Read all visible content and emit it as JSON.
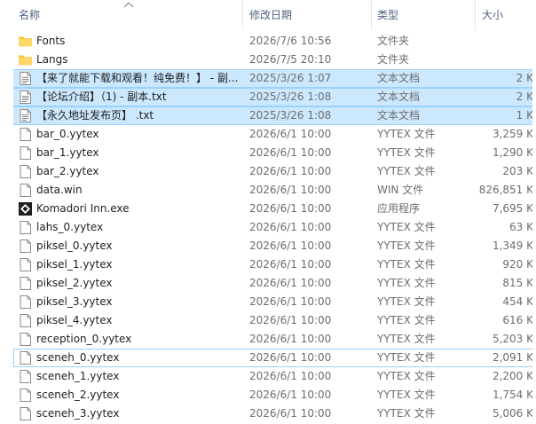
{
  "columns": {
    "name": "名称",
    "date": "修改日期",
    "type": "类型",
    "size": "大小"
  },
  "files": [
    {
      "name": "Fonts",
      "date": "2026/7/6 10:56",
      "type": "文件夹",
      "size": "",
      "icon": "folder-icon",
      "selected": false,
      "focus": false
    },
    {
      "name": "Langs",
      "date": "2026/7/5 20:10",
      "type": "文件夹",
      "size": "",
      "icon": "folder-icon",
      "selected": false,
      "focus": false
    },
    {
      "name": "【来了就能下载和观看！纯免费！】 - 副...",
      "date": "2025/3/26 1:07",
      "type": "文本文档",
      "size": "2 K",
      "icon": "text-file-icon",
      "selected": true,
      "focus": false
    },
    {
      "name": "【论坛介绍】（1) - 副本.txt",
      "date": "2025/3/26 1:08",
      "type": "文本文档",
      "size": "2 K",
      "icon": "text-file-icon",
      "selected": true,
      "focus": false
    },
    {
      "name": "【永久地址发布页】 .txt",
      "date": "2025/3/26 1:08",
      "type": "文本文档",
      "size": "1 K",
      "icon": "text-file-icon",
      "selected": true,
      "focus": false
    },
    {
      "name": "bar_0.yytex",
      "date": "2026/6/1 10:00",
      "type": "YYTEX 文件",
      "size": "3,259 K",
      "icon": "file-icon",
      "selected": false,
      "focus": false
    },
    {
      "name": "bar_1.yytex",
      "date": "2026/6/1 10:00",
      "type": "YYTEX 文件",
      "size": "1,290 K",
      "icon": "file-icon",
      "selected": false,
      "focus": false
    },
    {
      "name": "bar_2.yytex",
      "date": "2026/6/1 10:00",
      "type": "YYTEX 文件",
      "size": "203 K",
      "icon": "file-icon",
      "selected": false,
      "focus": false
    },
    {
      "name": "data.win",
      "date": "2026/6/1 10:00",
      "type": "WIN 文件",
      "size": "826,851 K",
      "icon": "file-icon",
      "selected": false,
      "focus": false
    },
    {
      "name": "Komadori Inn.exe",
      "date": "2026/6/1 10:00",
      "type": "应用程序",
      "size": "7,695 K",
      "icon": "app-icon",
      "selected": false,
      "focus": false
    },
    {
      "name": "lahs_0.yytex",
      "date": "2026/6/1 10:00",
      "type": "YYTEX 文件",
      "size": "63 K",
      "icon": "file-icon",
      "selected": false,
      "focus": false
    },
    {
      "name": "piksel_0.yytex",
      "date": "2026/6/1 10:00",
      "type": "YYTEX 文件",
      "size": "1,349 K",
      "icon": "file-icon",
      "selected": false,
      "focus": false
    },
    {
      "name": "piksel_1.yytex",
      "date": "2026/6/1 10:00",
      "type": "YYTEX 文件",
      "size": "920 K",
      "icon": "file-icon",
      "selected": false,
      "focus": false
    },
    {
      "name": "piksel_2.yytex",
      "date": "2026/6/1 10:00",
      "type": "YYTEX 文件",
      "size": "815 K",
      "icon": "file-icon",
      "selected": false,
      "focus": false
    },
    {
      "name": "piksel_3.yytex",
      "date": "2026/6/1 10:00",
      "type": "YYTEX 文件",
      "size": "454 K",
      "icon": "file-icon",
      "selected": false,
      "focus": false
    },
    {
      "name": "piksel_4.yytex",
      "date": "2026/6/1 10:00",
      "type": "YYTEX 文件",
      "size": "616 K",
      "icon": "file-icon",
      "selected": false,
      "focus": false
    },
    {
      "name": "reception_0.yytex",
      "date": "2026/6/1 10:00",
      "type": "YYTEX 文件",
      "size": "5,203 K",
      "icon": "file-icon",
      "selected": false,
      "focus": false
    },
    {
      "name": "sceneh_0.yytex",
      "date": "2026/6/1 10:00",
      "type": "YYTEX 文件",
      "size": "2,091 K",
      "icon": "file-icon",
      "selected": false,
      "focus": true
    },
    {
      "name": "sceneh_1.yytex",
      "date": "2026/6/1 10:00",
      "type": "YYTEX 文件",
      "size": "2,200 K",
      "icon": "file-icon",
      "selected": false,
      "focus": false
    },
    {
      "name": "sceneh_2.yytex",
      "date": "2026/6/1 10:00",
      "type": "YYTEX 文件",
      "size": "1,754 K",
      "icon": "file-icon",
      "selected": false,
      "focus": false
    },
    {
      "name": "sceneh_3.yytex",
      "date": "2026/6/1 10:00",
      "type": "YYTEX 文件",
      "size": "5,006 K",
      "icon": "file-icon",
      "selected": false,
      "focus": false
    }
  ]
}
